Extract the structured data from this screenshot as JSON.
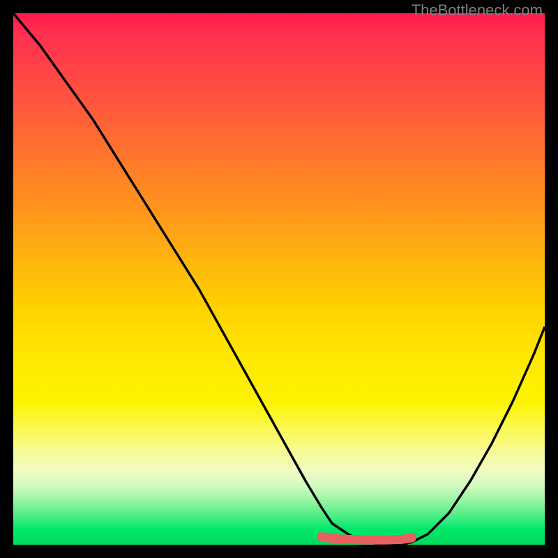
{
  "watermark": "TheBottleneck.com",
  "chart_data": {
    "type": "line",
    "title": "",
    "xlabel": "",
    "ylabel": "",
    "xlim": [
      0,
      100
    ],
    "ylim": [
      0,
      100
    ],
    "series": [
      {
        "name": "curve",
        "x": [
          0,
          5,
          10,
          15,
          20,
          25,
          30,
          35,
          40,
          45,
          50,
          55,
          58,
          60,
          63,
          66,
          70,
          73,
          75,
          78,
          82,
          86,
          90,
          94,
          98,
          100
        ],
        "values": [
          100,
          94,
          87,
          80,
          72,
          64,
          56,
          48,
          39,
          30,
          21,
          12,
          7,
          4,
          2,
          0.5,
          0,
          0,
          0.5,
          2,
          6,
          12,
          19,
          27,
          36,
          41
        ]
      },
      {
        "name": "highlight-band",
        "x": [
          58,
          60,
          63,
          66,
          70,
          73,
          75
        ],
        "values": [
          1.5,
          1.2,
          1.0,
          0.9,
          0.9,
          1.0,
          1.3
        ]
      }
    ],
    "gradient_stops": [
      {
        "pos": 0,
        "color": "#ff1a4d"
      },
      {
        "pos": 50,
        "color": "#ffd000"
      },
      {
        "pos": 80,
        "color": "#faf850"
      },
      {
        "pos": 100,
        "color": "#00d858"
      }
    ],
    "highlight_color": "#e86060"
  }
}
